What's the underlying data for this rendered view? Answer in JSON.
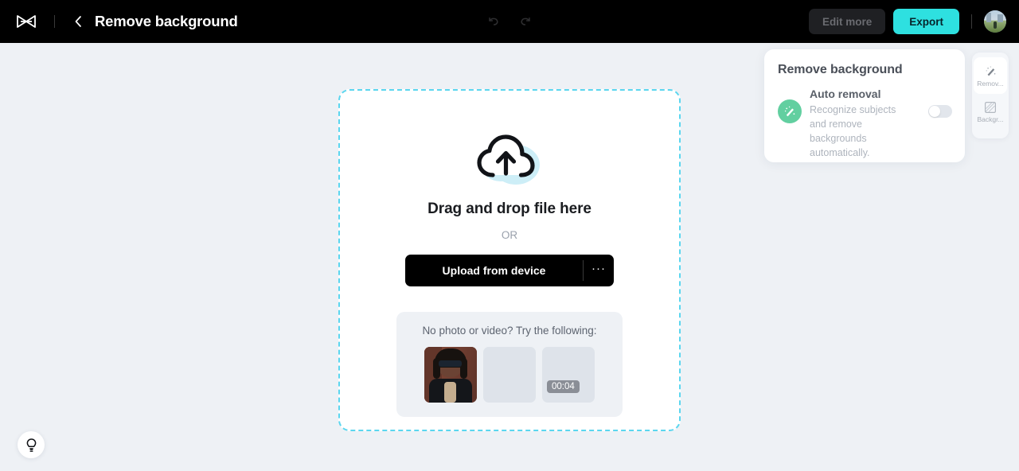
{
  "header": {
    "logo_icon": "capcut-logo-icon",
    "back_icon": "chevron-left-icon",
    "title": "Remove background",
    "undo_icon": "undo-icon",
    "redo_icon": "redo-icon",
    "edit_more_label": "Edit more",
    "export_label": "Export",
    "avatar_label": "",
    "bg_color": "#000000",
    "export_color": "#2ee0e0"
  },
  "dropzone": {
    "cloud_icon": "cloud-upload-icon",
    "title": "Drag and drop file here",
    "or_label": "OR",
    "upload_label": "Upload from device",
    "more_label": "···",
    "border_color": "#5bd6ef",
    "samples": {
      "label": "No photo or video? Try the following:",
      "items": [
        {
          "name": "sample-photo",
          "type": "photo",
          "duration": ""
        },
        {
          "name": "sample-placeholder",
          "type": "placeholder",
          "duration": ""
        },
        {
          "name": "sample-video",
          "type": "placeholder",
          "duration": "00:04"
        }
      ]
    }
  },
  "panel": {
    "title": "Remove background",
    "option_icon": "magic-wand-icon",
    "option_title": "Auto removal",
    "option_description": "Recognize subjects and remove backgrounds automatically.",
    "toggle_state": "off",
    "icon_color": "#62cfa0"
  },
  "rail": {
    "items": [
      {
        "icon": "magic-wand-icon",
        "label": "Remov...",
        "active": true
      },
      {
        "icon": "checker-square-icon",
        "label": "Backgr...",
        "active": false
      }
    ]
  },
  "hint": {
    "icon": "lightbulb-icon"
  }
}
